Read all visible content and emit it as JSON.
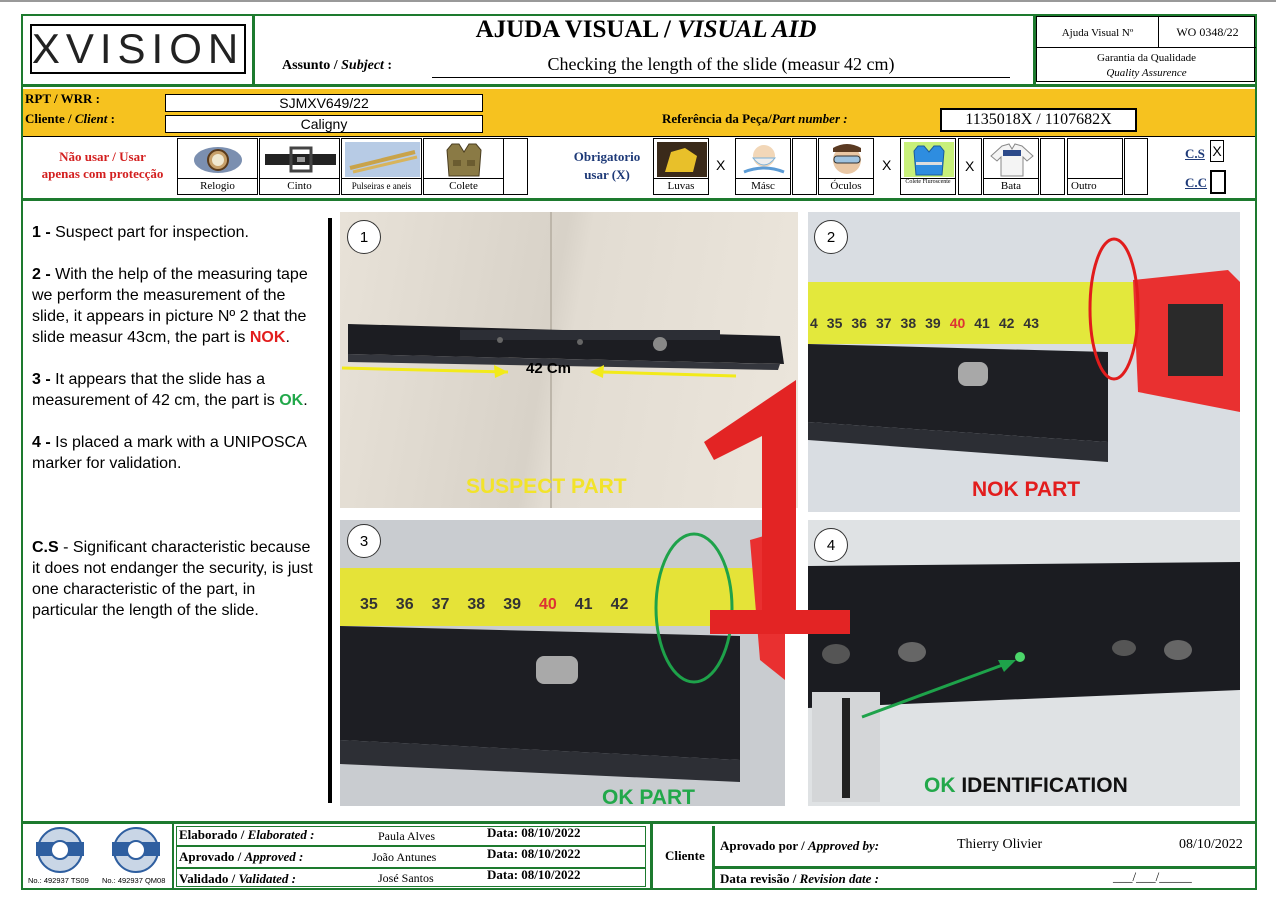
{
  "header": {
    "logo_text": "XVISION",
    "title_pt": "AJUDA VISUAL / ",
    "title_en": "VISUAL AID",
    "subject_label_pt": "Assunto / ",
    "subject_label_en": "Subject",
    "subject_value": "Checking the length of the slide (measur 42 cm)",
    "av_label": "Ajuda Visual Nº",
    "av_number": "WO 0348/22",
    "qa_pt": "Garantia da Qualidade",
    "qa_en": "Quality Assurence"
  },
  "info": {
    "rpt_label": "RPT / WRR :",
    "rpt_value": "SJMXV649/22",
    "client_label_pt": "Cliente / ",
    "client_label_en": "Client",
    "client_value": "Caligny",
    "part_label_pt": "Referência da Peça/",
    "part_label_en": "Part number :",
    "part_value": "1135018X / 1107682X"
  },
  "ppe": {
    "forbidden_label": "Não usar / Usar apenas com protecção",
    "forbidden_items": [
      "Relogio",
      "Cinto",
      "Pulseiras e aneis",
      "Colete"
    ],
    "mandatory_label": "Obrigatorio usar (X)",
    "mandatory_items": [
      {
        "label": "Luvas",
        "mark": "X"
      },
      {
        "label": "Másc",
        "mark": ""
      },
      {
        "label": "Óculos",
        "mark": "X"
      },
      {
        "label": "Colete Fluroscente",
        "mark": "X"
      },
      {
        "label": "Bata",
        "mark": ""
      },
      {
        "label": "Outro",
        "mark": ""
      }
    ],
    "cs_label": "C.S",
    "cs_mark": "X",
    "cc_label": "C.C"
  },
  "instructions": {
    "s1_num": "1 -",
    "s1_text": " Suspect part for inspection.",
    "s2_num": "2 -",
    "s2_text": " With the help of the measuring tape we perform the measurement of the slide, it appears in picture  Nº 2 that the slide measur 43cm, the part is ",
    "s2_status": "NOK",
    "s3_num": "3 -",
    "s3_text": " It appears that the slide has a measurement of 42 cm, the part is ",
    "s3_status": "OK",
    "s4_num": "4 -",
    "s4_text": " Is placed a mark with a UNIPOSCA marker for validation.",
    "cs_num": "C.S",
    "cs_text": " - Significant characteristic because it does not endanger the security, is just one characteristic of the part, in particular the length of the slide."
  },
  "photos": {
    "p1_num": "1",
    "p1_measure": "42 Cm",
    "p1_caption": "SUSPECT PART",
    "p2_num": "2",
    "p2_caption": "NOK PART",
    "p3_num": "3",
    "p3_caption": "OK PART",
    "p4_num": "4",
    "p4_caption_ok": "OK",
    "p4_caption_rest": " IDENTIFICATION",
    "tape2_ticks": [
      "4",
      "35",
      "36",
      "37",
      "38",
      "39",
      "40",
      "41",
      "42",
      "43"
    ],
    "tape3_ticks": [
      "35",
      "36",
      "37",
      "38",
      "39",
      "40",
      "41",
      "42"
    ],
    "big_number": "1"
  },
  "footer": {
    "cert1": "No.: 492937 TS09",
    "cert2": "No.: 492937 QM08",
    "elab_label_pt": "Elaborado / ",
    "elab_label_en": "Elaborated :",
    "elab_name": "Paula Alves",
    "elab_date": "Data: 08/10/2022",
    "apr_label_pt": "Aprovado / ",
    "apr_label_en": "Approved :",
    "apr_name": "João Antunes",
    "apr_date": "Data: 08/10/2022",
    "val_label_pt": "Validado / ",
    "val_label_en": "Validated :",
    "val_name": "José Santos",
    "val_date": "Data: 08/10/2022",
    "cliente": "Cliente",
    "approved_by_pt": "Aprovado por / ",
    "approved_by_en": "Approved by:",
    "approved_by_name": "Thierry Olivier",
    "approved_by_date": "08/10/2022",
    "rev_label_pt": "Data revisão / ",
    "rev_label_en": "Revision date :",
    "rev_value": "___/___/_____"
  },
  "colors": {
    "frame": "#1d7a2e",
    "band": "#f6c21f",
    "nok": "#e21d1d",
    "ok": "#22a84a",
    "suspect": "#f2e32a"
  }
}
